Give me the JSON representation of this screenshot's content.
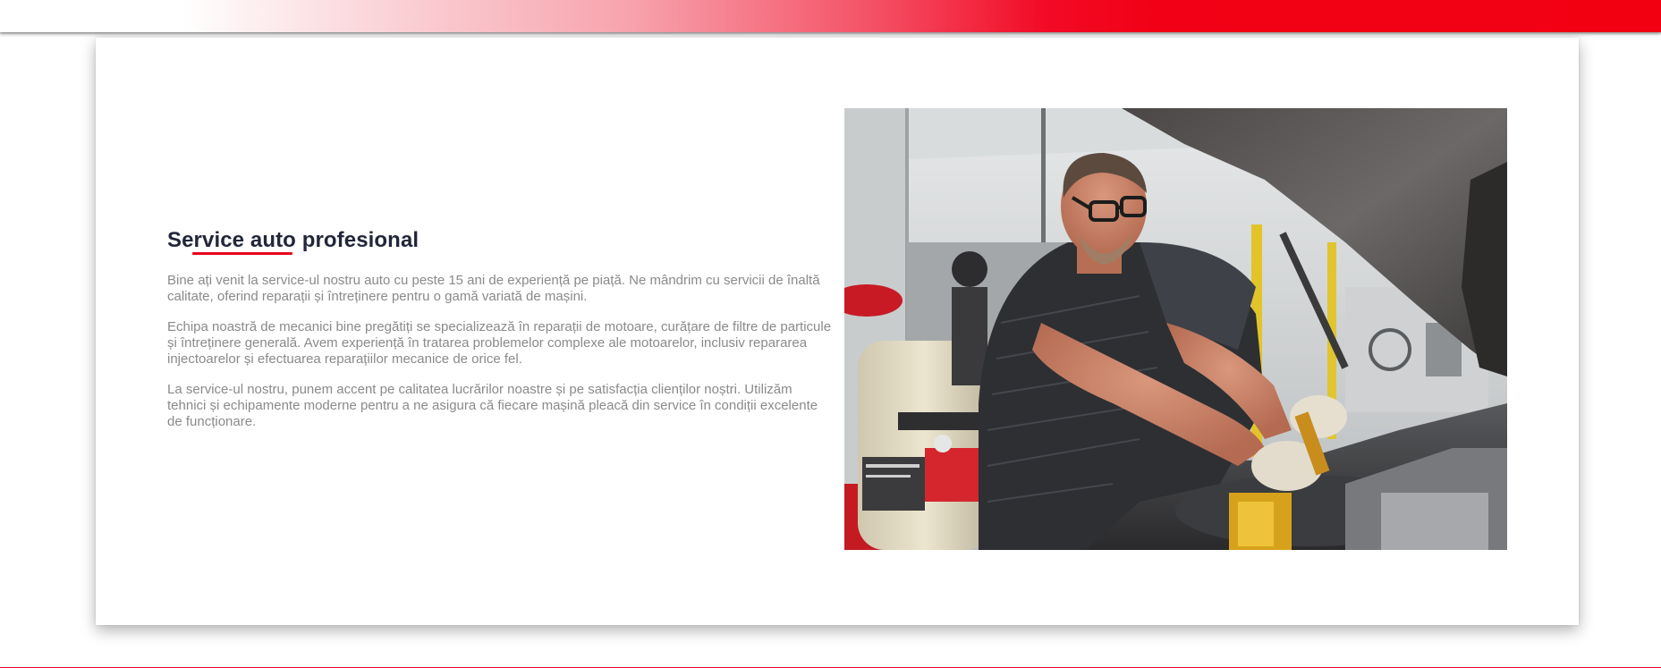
{
  "colors": {
    "accent": "#e8041c",
    "title": "#22263a",
    "body_text": "#8a8a8a"
  },
  "section": {
    "title": "Service auto profesional",
    "paragraphs": [
      "Bine ați venit la service-ul nostru auto cu peste 15 ani de experiență pe piață. Ne mândrim cu servicii de înaltă calitate, oferind reparații și întreținere pentru o gamă variată de mașini.",
      "Echipa noastră de mecanici bine pregătiți se specializează în reparații de motoare, curățare de filtre de particule și întreținere generală. Avem experiență în tratarea problemelor complexe ale motoarelor, inclusiv repararea injectoarelor și efectuarea reparațiilor mecanice de orice fel.",
      "La service-ul nostru, punem accent pe calitatea lucrărilor noastre și pe satisfacția clienților noștri. Utilizăm tehnici și echipamente moderne pentru a ne asigura că fiecare mașină pleacă din service în condiții excelente de funcționare."
    ]
  },
  "image": {
    "subject": "mechanic-working-on-car-engine-photo"
  }
}
